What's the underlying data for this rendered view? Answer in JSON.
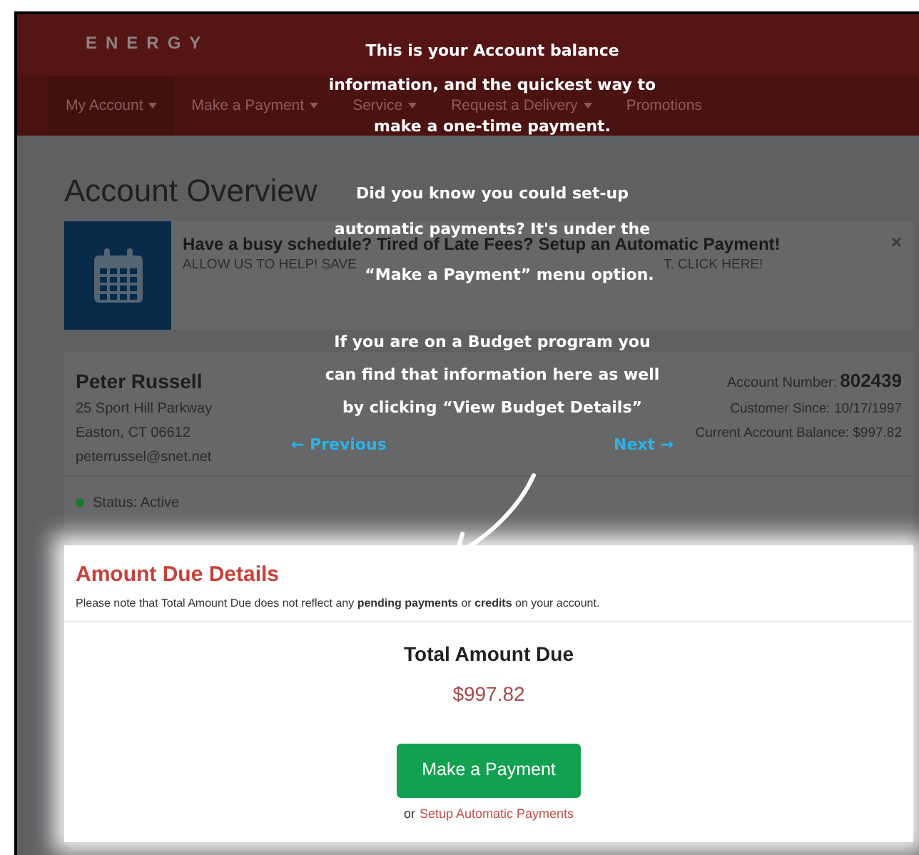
{
  "header": {
    "logo": "ENERGY",
    "nav": [
      {
        "label": "My Account",
        "has_menu": true,
        "selected": true
      },
      {
        "label": "Make a Payment",
        "has_menu": true,
        "selected": false
      },
      {
        "label": "Service",
        "has_menu": true,
        "selected": false
      },
      {
        "label": "Request a Delivery",
        "has_menu": true,
        "selected": false
      },
      {
        "label": "Promotions",
        "has_menu": false,
        "selected": false
      }
    ]
  },
  "page_title": "Account Overview",
  "promo": {
    "title": "Have a busy schedule? Tired of Late Fees? Setup an Automatic Payment!",
    "subtitle_start": "ALLOW US TO HELP! SAVE",
    "subtitle_end": "T. CLICK HERE!",
    "close": "×"
  },
  "account": {
    "name": "Peter Russell",
    "address": [
      "25 Sport Hill Parkway",
      "Easton, CT 06612",
      "peterrussel@snet.net"
    ],
    "account_number_label": "Account Number:",
    "account_number": "802439",
    "customer_since": "Customer Since: 10/17/1997",
    "balance": "Current Account Balance: $997.82",
    "status": {
      "text": "Status: Active",
      "color": "#1a7a2a"
    }
  },
  "amount_due": {
    "title": "Amount Due Details",
    "note": "Please note that Total Amount Due does not reflect any **pending payments** or **credits** on your account.",
    "total_label": "Total Amount Due",
    "total": "$997.82",
    "button": "Make a Payment",
    "or": "or",
    "link": "Setup Automatic Payments"
  },
  "tour": {
    "steps": [
      {
        "lines": [
          "This is your Account balance",
          "information, and the quickest way to",
          "make a one-time payment."
        ]
      },
      {
        "lines": [
          "Did you know you could set-up",
          "automatic payments? It's under the",
          "“Make a Payment” menu option."
        ]
      },
      {
        "lines": [
          "If you are on a Budget program you",
          "can find that information here as well",
          "by clicking “View Budget Details”"
        ]
      }
    ],
    "previous": "← Previous",
    "next": "Next →"
  }
}
